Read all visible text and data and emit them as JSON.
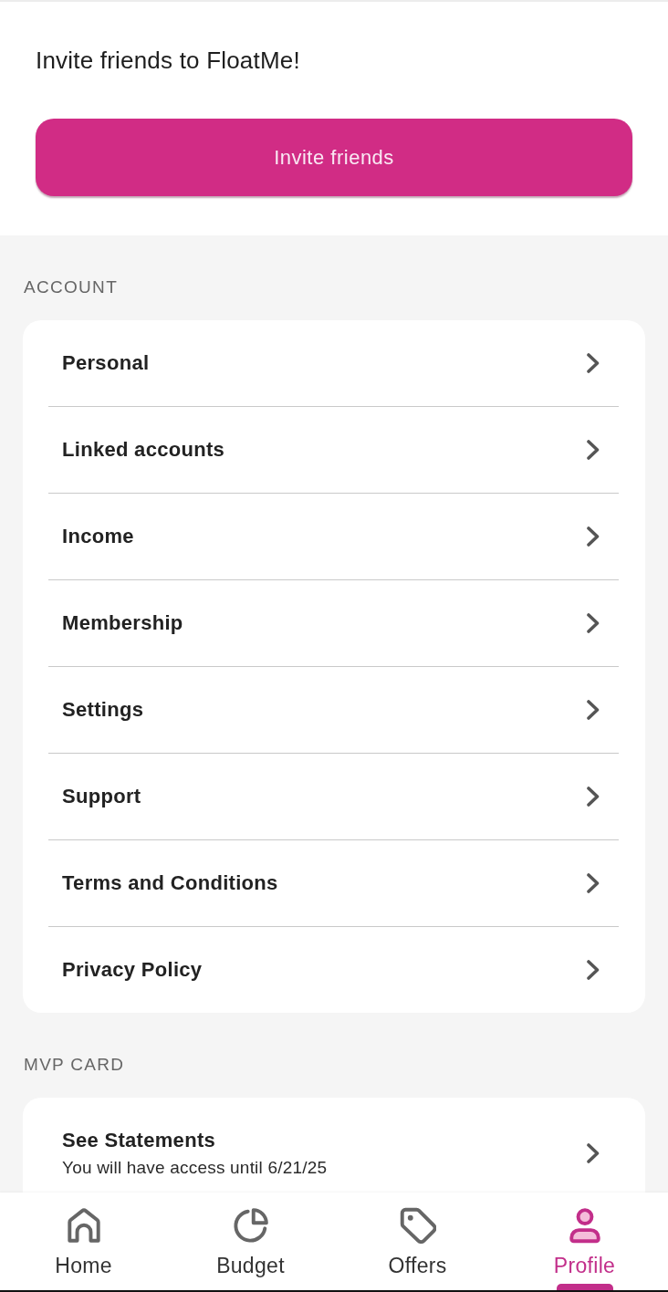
{
  "invite": {
    "title": "Invite friends to FloatMe!",
    "button": "Invite friends"
  },
  "sections": [
    {
      "heading": "ACCOUNT",
      "items": [
        {
          "label": "Personal"
        },
        {
          "label": "Linked accounts"
        },
        {
          "label": "Income"
        },
        {
          "label": "Membership"
        },
        {
          "label": "Settings"
        },
        {
          "label": "Support"
        },
        {
          "label": "Terms and Conditions"
        },
        {
          "label": "Privacy Policy"
        }
      ]
    },
    {
      "heading": "MVP CARD",
      "items": [
        {
          "label": "See Statements",
          "subtitle": "You will have access until 6/21/25"
        }
      ]
    }
  ],
  "bottom_nav": [
    {
      "label": "Home",
      "selected": false
    },
    {
      "label": "Budget",
      "selected": false
    },
    {
      "label": "Offers",
      "selected": false
    },
    {
      "label": "Profile",
      "selected": true
    }
  ]
}
